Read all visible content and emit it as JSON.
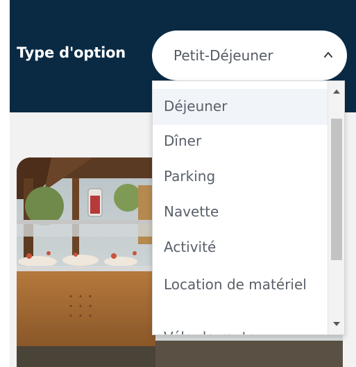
{
  "header": {
    "label": "Type d'option",
    "select": {
      "value": "Petit-Déjeuner"
    }
  },
  "dropdown": {
    "options": [
      "Déjeuner",
      "Dîner",
      "Parking",
      "Navette",
      "Activité",
      "Location de matériel",
      "Vélo de route"
    ]
  },
  "icons": {
    "select_chevron": "chevron-up-icon",
    "scroll_up": "arrow-up-icon",
    "scroll_down": "arrow-down-icon"
  },
  "colors": {
    "header_bg": "#0a2a44",
    "text_gray": "#59606a",
    "content_bg": "#f2f2f2"
  }
}
